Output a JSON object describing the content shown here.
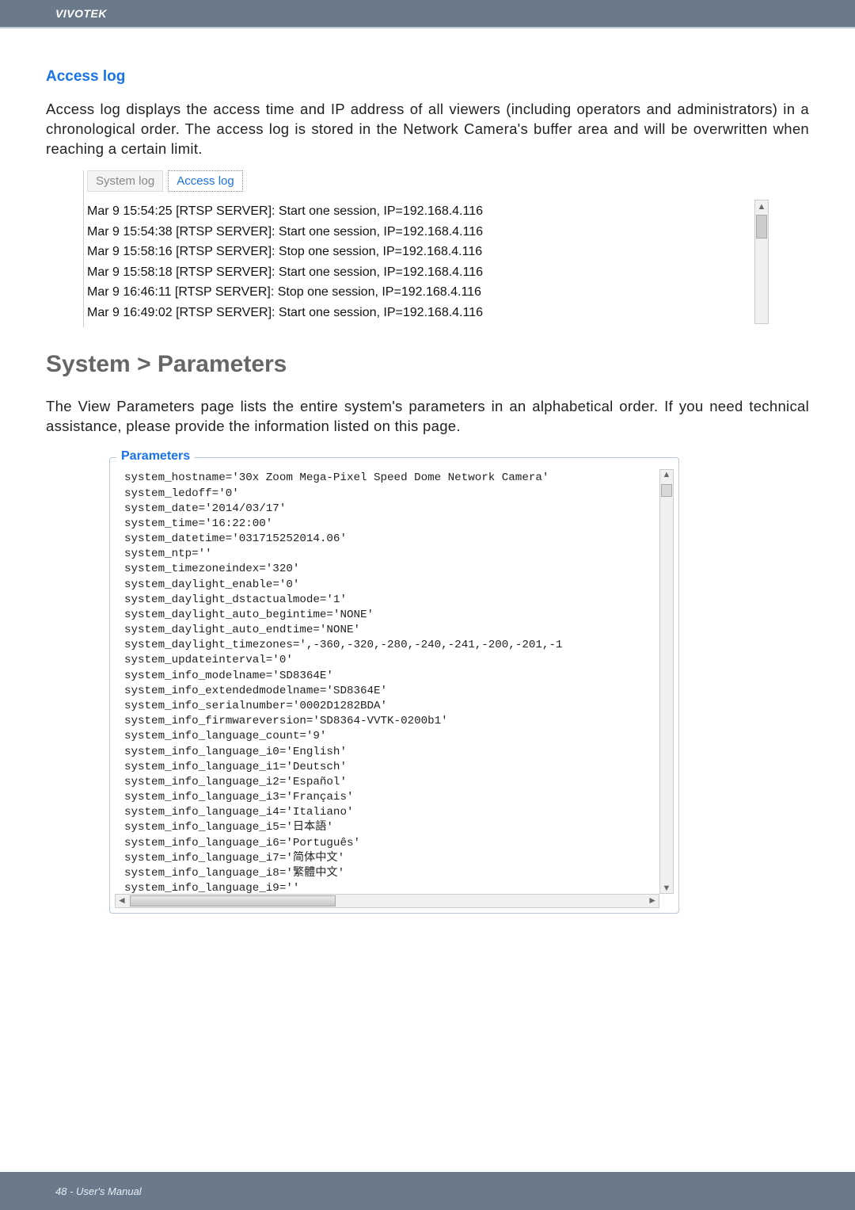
{
  "header": {
    "brand": "VIVOTEK"
  },
  "accesslog": {
    "title": "Access log",
    "desc": "Access log displays the access time and IP address of all viewers (including operators and administrators) in a chronological order. The access log is stored in the Network Camera's buffer area and will be overwritten when reaching a certain limit.",
    "tabs": {
      "system": "System log",
      "access": "Access log"
    },
    "lines": [
      "Mar 9 15:54:25 [RTSP SERVER]: Start one session, IP=192.168.4.116",
      "Mar 9 15:54:38 [RTSP SERVER]: Start one session, IP=192.168.4.116",
      "Mar 9 15:58:16 [RTSP SERVER]: Stop one session, IP=192.168.4.116",
      "Mar 9 15:58:18 [RTSP SERVER]: Start one session, IP=192.168.4.116",
      "Mar 9 16:46:11 [RTSP SERVER]: Stop one session, IP=192.168.4.116",
      "Mar 9 16:49:02 [RTSP SERVER]: Start one session, IP=192.168.4.116"
    ]
  },
  "parameters": {
    "heading": "System > Parameters",
    "desc": "The View Parameters page lists the entire system's parameters in an alphabetical order. If you need technical assistance, please provide the information listed on this page.",
    "legend": "Parameters",
    "lines": [
      "system_hostname='30x Zoom Mega-Pixel Speed Dome Network Camera'",
      "system_ledoff='0'",
      "system_date='2014/03/17'",
      "system_time='16:22:00'",
      "system_datetime='031715252014.06'",
      "system_ntp=''",
      "system_timezoneindex='320'",
      "system_daylight_enable='0'",
      "system_daylight_dstactualmode='1'",
      "system_daylight_auto_begintime='NONE'",
      "system_daylight_auto_endtime='NONE'",
      "system_daylight_timezones=',-360,-320,-280,-240,-241,-200,-201,-1",
      "system_updateinterval='0'",
      "system_info_modelname='SD8364E'",
      "system_info_extendedmodelname='SD8364E'",
      "system_info_serialnumber='0002D1282BDA'",
      "system_info_firmwareversion='SD8364-VVTK-0200b1'",
      "system_info_language_count='9'",
      "system_info_language_i0='English'",
      "system_info_language_i1='Deutsch'",
      "system_info_language_i2='Español'",
      "system_info_language_i3='Français'",
      "system_info_language_i4='Italiano'",
      "system_info_language_i5='日本語'",
      "system_info_language_i6='Português'",
      "system_info_language_i7='简体中文'",
      "system_info_language_i8='繁體中文'",
      "system_info_language_i9=''"
    ]
  },
  "footer": {
    "text": "48 - User's Manual"
  }
}
